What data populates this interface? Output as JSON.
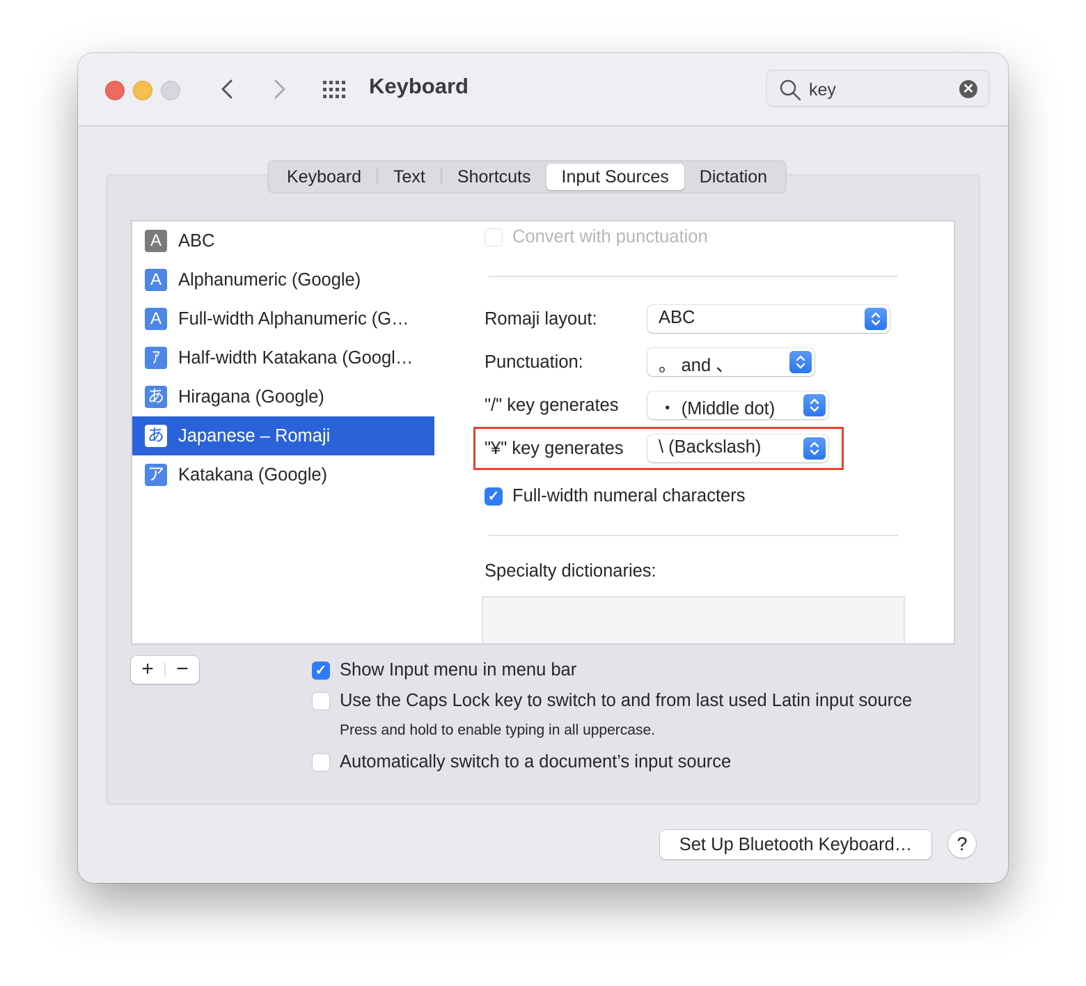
{
  "window": {
    "title": "Keyboard",
    "search": {
      "value": "key",
      "placeholder": "Search"
    }
  },
  "icons": {
    "back": "chevron-left-icon",
    "forward": "chevron-right-icon",
    "grid": "grid-icon",
    "search": "search-icon",
    "clear": "clear-icon",
    "clear_glyph": "✕",
    "check_glyph": "✓"
  },
  "tabs": [
    {
      "label": "Keyboard",
      "active": false
    },
    {
      "label": "Text",
      "active": false
    },
    {
      "label": "Shortcuts",
      "active": false
    },
    {
      "label": "Input Sources",
      "active": true
    },
    {
      "label": "Dictation",
      "active": false
    }
  ],
  "input_sources": [
    {
      "icon": "A",
      "label": "ABC",
      "selected": false
    },
    {
      "icon": "A",
      "label": "Alphanumeric (Google)",
      "selected": false
    },
    {
      "icon": "A",
      "label": "Full-width Alphanumeric (G…",
      "selected": false
    },
    {
      "icon": "ｱ",
      "label": "Half-width Katakana (Googl…",
      "selected": false
    },
    {
      "icon": "あ",
      "label": "Hiragana (Google)",
      "selected": false
    },
    {
      "icon": "あ",
      "label": "Japanese – Romaji",
      "selected": true
    },
    {
      "icon": "ア",
      "label": "Katakana (Google)",
      "selected": false
    }
  ],
  "settings": {
    "convert_punctuation": {
      "label": "Convert with punctuation",
      "checked": false,
      "enabled": false
    },
    "romaji_layout": {
      "label": "Romaji layout:",
      "value": "ABC"
    },
    "punctuation": {
      "label": "Punctuation:",
      "value": "。 and 、"
    },
    "slash_key": {
      "label": "\"/\" key generates",
      "value": "・ (Middle dot)"
    },
    "yen_key": {
      "label": "\"¥\" key generates",
      "value": "\\ (Backslash)"
    },
    "full_width_numerals": {
      "label": "Full-width numeral characters",
      "checked": true
    },
    "specialty_dictionaries": {
      "label": "Specialty dictionaries:"
    }
  },
  "list_controls": {
    "add": "+",
    "remove": "−"
  },
  "options": {
    "show_input_menu": {
      "label": "Show Input menu in menu bar",
      "checked": true
    },
    "caps_lock": {
      "label": "Use the Caps Lock key to switch to and from last used Latin input source",
      "checked": false,
      "note": "Press and hold to enable typing in all uppercase."
    },
    "auto_switch": {
      "label": "Automatically switch to a document’s input source",
      "checked": false
    }
  },
  "footer": {
    "bluetooth_button": "Set Up Bluetooth Keyboard…",
    "help": "?"
  },
  "colors": {
    "accent": "#2f7cf6",
    "selection": "#2a62d9",
    "highlight": "#e8412c"
  }
}
